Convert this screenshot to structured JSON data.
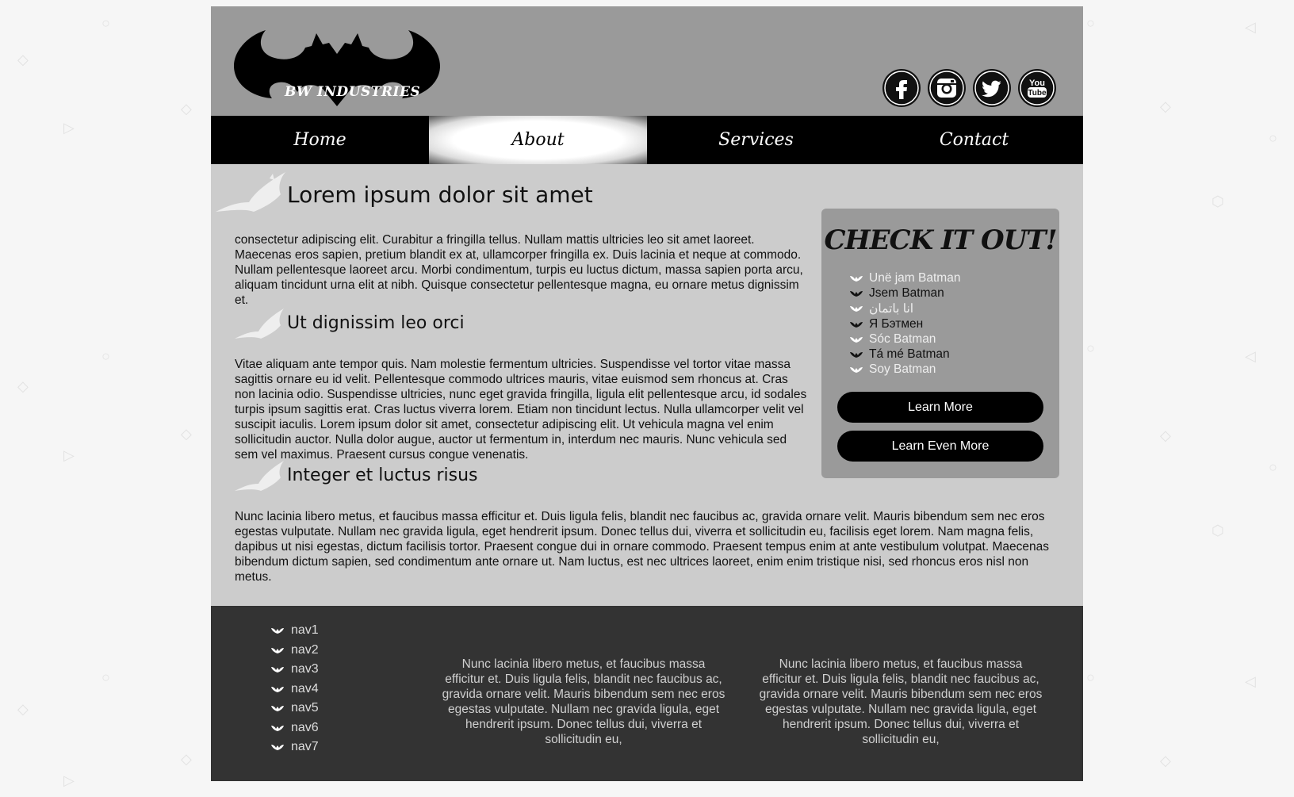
{
  "header": {
    "logo_text": "BW INDUSTRIES",
    "socials": [
      {
        "name": "facebook"
      },
      {
        "name": "instagram"
      },
      {
        "name": "twitter"
      },
      {
        "name": "youtube",
        "label_top": "You",
        "label_bottom": "Tube"
      }
    ]
  },
  "nav": {
    "items": [
      {
        "label": "Home"
      },
      {
        "label": "About",
        "active": true
      },
      {
        "label": "Services"
      },
      {
        "label": "Contact"
      }
    ]
  },
  "main": {
    "title": "Lorem ipsum dolor sit amet",
    "intro": "consectetur adipiscing elit. Curabitur a fringilla tellus. Nullam mattis ultricies leo sit amet laoreet. Maecenas eros sapien, pretium blandit ex at, ullamcorper fringilla ex. Duis lacinia et neque at commodo. Nullam pellentesque laoreet arcu. Morbi condimentum, turpis eu luctus dictum, massa sapien porta arcu, aliquam tincidunt urna elit at nibh. Quisque consectetur pellentesque magna, eu ornare metus dignissim et.",
    "section2_title": "Ut dignissim leo orci",
    "section2_text": "Vitae aliquam ante tempor quis. Nam molestie fermentum ultricies. Suspendisse vel tortor vitae massa sagittis ornare eu id velit. Pellentesque commodo ultrices mauris, vitae euismod sem rhoncus at. Cras non lacinia odio. Suspendisse ultricies, nunc eget gravida fringilla, ligula elit pellentesque arcu, id sodales turpis ipsum sagittis erat. Cras luctus viverra lorem. Etiam non tincidunt lectus. Nulla ullamcorper velit vel suscipit iaculis. Lorem ipsum dolor sit amet, consectetur adipiscing elit. Ut vehicula magna vel enim sollicitudin auctor. Nulla dolor augue, auctor ut fermentum in, interdum nec mauris. Nunc vehicula sed sem vel maximus. Praesent cursus congue venenatis.",
    "section3_title": "Integer et luctus risus",
    "section3_text": "Nunc lacinia libero metus, et faucibus massa efficitur et. Duis ligula felis, blandit nec faucibus ac, gravida ornare velit. Mauris bibendum sem nec eros egestas vulputate. Nullam nec gravida ligula, eget hendrerit ipsum. Donec tellus dui, viverra et sollicitudin eu, facilisis eget lorem. Nam magna felis, dapibus ut nisi egestas, dictum facilisis tortor. Praesent congue dui in ornare commodo. Praesent tempus enim at ante vestibulum volutpat. Maecenas bibendum dictum sapien, sed condimentum ante ornare ut. Nam luctus, est nec ultrices laoreet, enim enim tristique nisi, sed rhoncus eros nisl non metus."
  },
  "aside": {
    "title": "CHECK IT OUT!",
    "items": [
      {
        "label": "Unë jam Batman",
        "color": "#eeeeee",
        "icon_color": "#ffffff"
      },
      {
        "label": "Jsem Batman",
        "color": "#111111",
        "icon_color": "#111111"
      },
      {
        "label": "انا باتمان",
        "color": "#eeeeee",
        "icon_color": "#ffffff"
      },
      {
        "label": "Я Бэтмен",
        "color": "#111111",
        "icon_color": "#111111"
      },
      {
        "label": "Sóc Batman",
        "color": "#eeeeee",
        "icon_color": "#ffffff"
      },
      {
        "label": "Tá mé Batman",
        "color": "#111111",
        "icon_color": "#111111"
      },
      {
        "label": "Soy Batman",
        "color": "#eeeeee",
        "icon_color": "#ffffff"
      }
    ],
    "learn_more": "Learn More",
    "learn_even_more": "Learn Even More"
  },
  "footer": {
    "nav": [
      "nav1",
      "nav2",
      "nav3",
      "nav4",
      "nav5",
      "nav6",
      "nav7"
    ],
    "text_left": "Nunc lacinia libero metus, et faucibus massa efficitur et. Duis ligula felis, blandit nec faucibus ac, gravida ornare velit. Mauris bibendum sem nec eros egestas vulputate. Nullam nec gravida ligula, eget hendrerit ipsum. Donec tellus dui, viverra et sollicitudin eu,",
    "text_right": "Nunc lacinia libero metus, et faucibus massa efficitur et. Duis ligula felis, blandit nec faucibus ac, gravida ornare velit. Mauris bibendum sem nec eros egestas vulputate. Nullam nec gravida ligula, eget hendrerit ipsum. Donec tellus dui, viverra et sollicitudin eu,"
  },
  "colors": {
    "page_bg": "#f6f6f6",
    "header_bg": "#9a9a9a",
    "content_bg": "#cccccc",
    "nav_bg": "#000000",
    "footer_bg": "#333333"
  }
}
